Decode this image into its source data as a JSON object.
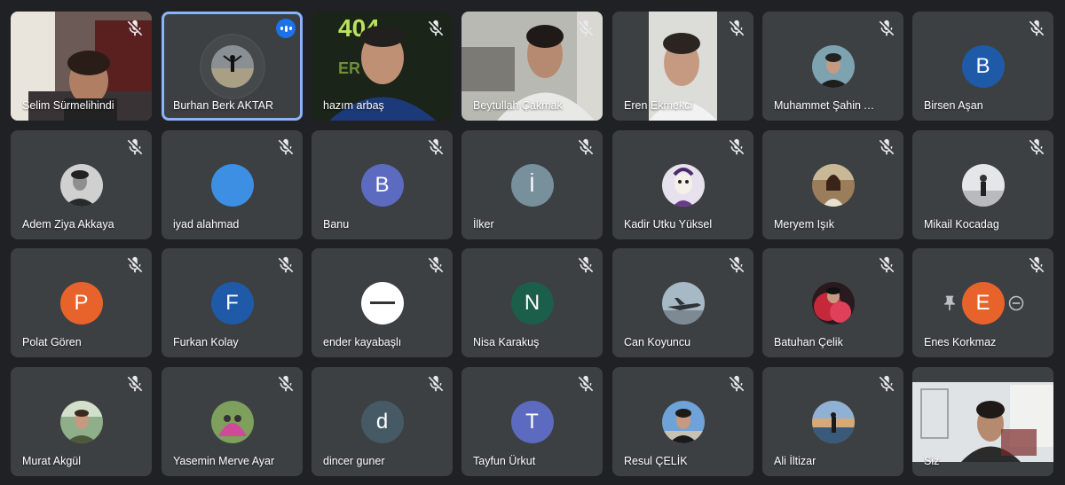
{
  "meeting": {
    "self_label": "Siz",
    "active_speaker_color": "#8ab4f8",
    "tile_bg": "#3c4043",
    "page_bg": "#202124"
  },
  "participants": [
    {
      "name": "Selim Sürmelihindi",
      "kind": "video",
      "muted": true,
      "scene": "room-warm"
    },
    {
      "name": "Burhan Berk AKTAR",
      "kind": "photo",
      "muted": false,
      "speaking": true,
      "photo": "figure-field",
      "ring": true
    },
    {
      "name": "hazım arbaş",
      "kind": "video",
      "muted": true,
      "scene": "neon-404",
      "scene_text": "404"
    },
    {
      "name": "Beytullah Çakmak",
      "kind": "video",
      "muted": true,
      "scene": "room-light"
    },
    {
      "name": "Eren Ekmekci",
      "kind": "video",
      "muted": true,
      "scene": "portrait-narrow"
    },
    {
      "name": "Muhammet Şahin Adi...",
      "kind": "photo",
      "muted": true,
      "photo": "portrait-dark"
    },
    {
      "name": "Birsen Aşan",
      "kind": "initial",
      "muted": true,
      "initial": "B",
      "color": "#1e5aa8"
    },
    {
      "name": "Adem Ziya Akkaya",
      "kind": "photo",
      "muted": true,
      "photo": "portrait-bw"
    },
    {
      "name": "iyad alahmad",
      "kind": "initial",
      "muted": true,
      "initial": "",
      "color": "#3d8fe3"
    },
    {
      "name": "Banu",
      "kind": "initial",
      "muted": true,
      "initial": "B",
      "color": "#5c6bc0"
    },
    {
      "name": "İlker",
      "kind": "initial",
      "muted": true,
      "initial": "İ",
      "color": "#78909c"
    },
    {
      "name": "Kadir Utku Yüksel",
      "kind": "photo",
      "muted": true,
      "photo": "cartoon"
    },
    {
      "name": "Meryem Işık",
      "kind": "photo",
      "muted": true,
      "photo": "portrait-outdoor"
    },
    {
      "name": "Mikail Kocadag",
      "kind": "photo",
      "muted": true,
      "photo": "figure-light"
    },
    {
      "name": "Polat Gören",
      "kind": "initial",
      "muted": true,
      "initial": "P",
      "color": "#e8622c"
    },
    {
      "name": "Furkan Kolay",
      "kind": "initial",
      "muted": true,
      "initial": "F",
      "color": "#1e5aa8"
    },
    {
      "name": "ender kayabaşlı",
      "kind": "photo",
      "muted": true,
      "photo": "white-logo"
    },
    {
      "name": "Nisa Karakuş",
      "kind": "initial",
      "muted": true,
      "initial": "N",
      "color": "#1b5e4a"
    },
    {
      "name": "Can Koyuncu",
      "kind": "photo",
      "muted": true,
      "photo": "jet"
    },
    {
      "name": "Batuhan Çelik",
      "kind": "photo",
      "muted": true,
      "photo": "red-smoke"
    },
    {
      "name": "Enes Korkmaz",
      "kind": "initial",
      "muted": true,
      "initial": "E",
      "color": "#e8622c",
      "hover": true
    },
    {
      "name": "Murat Akgül",
      "kind": "photo",
      "muted": true,
      "photo": "portrait-green"
    },
    {
      "name": "Yasemin Merve Ayar",
      "kind": "photo",
      "muted": true,
      "photo": "pink"
    },
    {
      "name": "dincer guner",
      "kind": "initial",
      "muted": true,
      "initial": "d",
      "color": "#455a64"
    },
    {
      "name": "Tayfun Ürkut",
      "kind": "initial",
      "muted": true,
      "initial": "T",
      "color": "#5c6bc0"
    },
    {
      "name": "Resul ÇELİK",
      "kind": "photo",
      "muted": true,
      "photo": "portrait-sky"
    },
    {
      "name": "Ali İltizar",
      "kind": "photo",
      "muted": true,
      "photo": "sunset"
    },
    {
      "name": "Siz",
      "kind": "video",
      "muted": false,
      "scene": "self-room",
      "self": true
    }
  ]
}
